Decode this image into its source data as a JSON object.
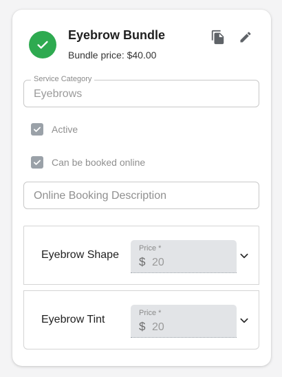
{
  "header": {
    "title": "Eyebrow Bundle",
    "subtitle": "Bundle price: $40.00",
    "status_icon": "check-circle-icon",
    "status_color": "#2eaa50",
    "actions": [
      "copy-icon",
      "edit-icon"
    ]
  },
  "form": {
    "category": {
      "label": "Service Category",
      "value": "Eyebrows"
    },
    "active": {
      "label": "Active",
      "checked": true
    },
    "online_bookable": {
      "label": "Can be booked online",
      "checked": true
    },
    "online_description": {
      "placeholder": "Online Booking Description"
    }
  },
  "services": [
    {
      "name": "Eyebrow Shape",
      "price_label": "Price *",
      "currency": "$",
      "price": "20"
    },
    {
      "name": "Eyebrow Tint",
      "price_label": "Price *",
      "currency": "$",
      "price": "20"
    }
  ]
}
